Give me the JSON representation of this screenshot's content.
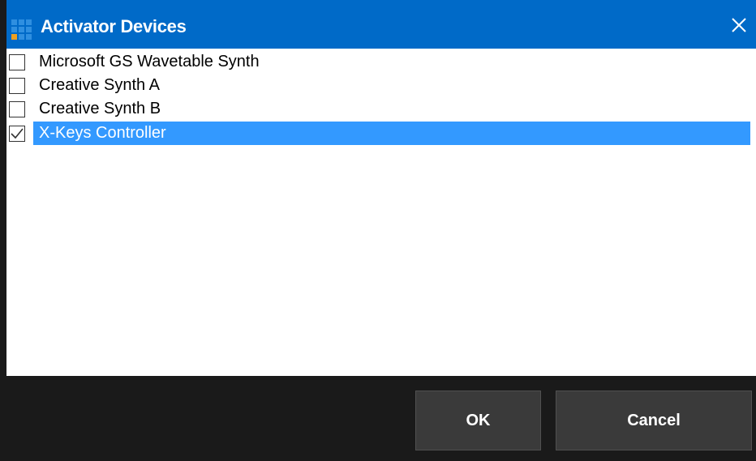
{
  "window": {
    "title": "Activator Devices",
    "accent_color": "#006ac8",
    "selection_color": "#3399ff",
    "app_icon": "grid-logo-icon",
    "close_icon": "close-icon"
  },
  "devices": [
    {
      "label": "Microsoft GS Wavetable Synth",
      "checked": false,
      "selected": false
    },
    {
      "label": "Creative Synth A",
      "checked": false,
      "selected": false
    },
    {
      "label": "Creative Synth B",
      "checked": false,
      "selected": false
    },
    {
      "label": "X-Keys Controller",
      "checked": true,
      "selected": true
    }
  ],
  "buttons": {
    "ok_label": "OK",
    "cancel_label": "Cancel"
  }
}
